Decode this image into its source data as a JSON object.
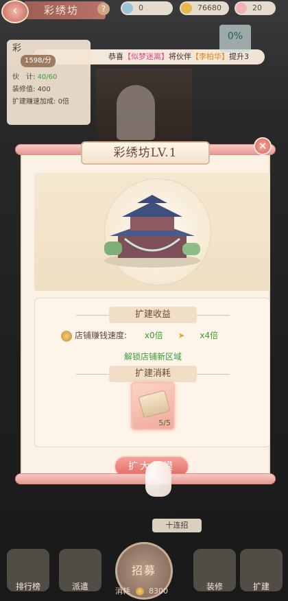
{
  "topbar": {
    "back_icon": "back-arrow-icon",
    "shop_title": "彩绣坊",
    "help": "?",
    "res1": "0",
    "res2": "76680",
    "res3": "20"
  },
  "announce": {
    "prefix": "恭喜",
    "name1": "【似梦迷离】",
    "mid": "将伙伴",
    "name2": "【李柏华】",
    "suffix": "提升3"
  },
  "stats": {
    "shop_name": "彩",
    "income": "1598/分",
    "partners_label": "伙　计:",
    "partners_value": "40/60",
    "decor_label": "装修值:",
    "decor_value": "400",
    "speed_label": "扩建赚速加成:",
    "speed_value": "0倍"
  },
  "pct": "0%",
  "dialog": {
    "title": "彩绣坊LV.1",
    "close": "✕",
    "gain_title": "扩建收益",
    "speed_label": "店铺赚钱速度:",
    "speed_from": "x0倍",
    "speed_to": "x4倍",
    "unlock": "解锁店铺新区域",
    "cost_title": "扩建消耗",
    "item_count": "5/5",
    "expand_button": "扩大规模"
  },
  "bottom": {
    "ten_draw": "十连招",
    "rank": "排行榜",
    "dispatch": "派遣",
    "recruit": "招募",
    "decorate": "装修",
    "expand": "扩建",
    "cost_label": "消耗",
    "cost_value": "8300"
  }
}
